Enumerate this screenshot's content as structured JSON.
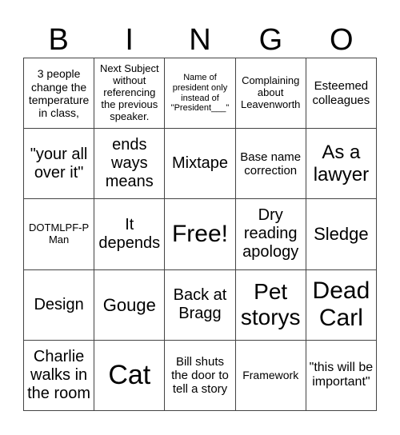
{
  "header": [
    "B",
    "I",
    "N",
    "G",
    "O"
  ],
  "cells": [
    [
      "3 people change the temperature in class,",
      "Next Subject without referencing the previous speaker.",
      "Name of president only instead of \"President___\"",
      "Complaining about Leavenworth",
      "Esteemed colleagues"
    ],
    [
      "\"your all over it\"",
      "ends ways means",
      "Mixtape",
      "Base name correction",
      "As a lawyer"
    ],
    [
      "DOTMLPF-P Man",
      "It depends",
      "Free!",
      "Dry reading apology",
      "Sledge"
    ],
    [
      "Design",
      "Gouge",
      "Back at Bragg",
      "Pet storys",
      "Dead Carl"
    ],
    [
      "Charlie walks in the room",
      "Cat",
      "Bill shuts the door to tell a story",
      "Framework",
      "\"this will be important\""
    ]
  ]
}
